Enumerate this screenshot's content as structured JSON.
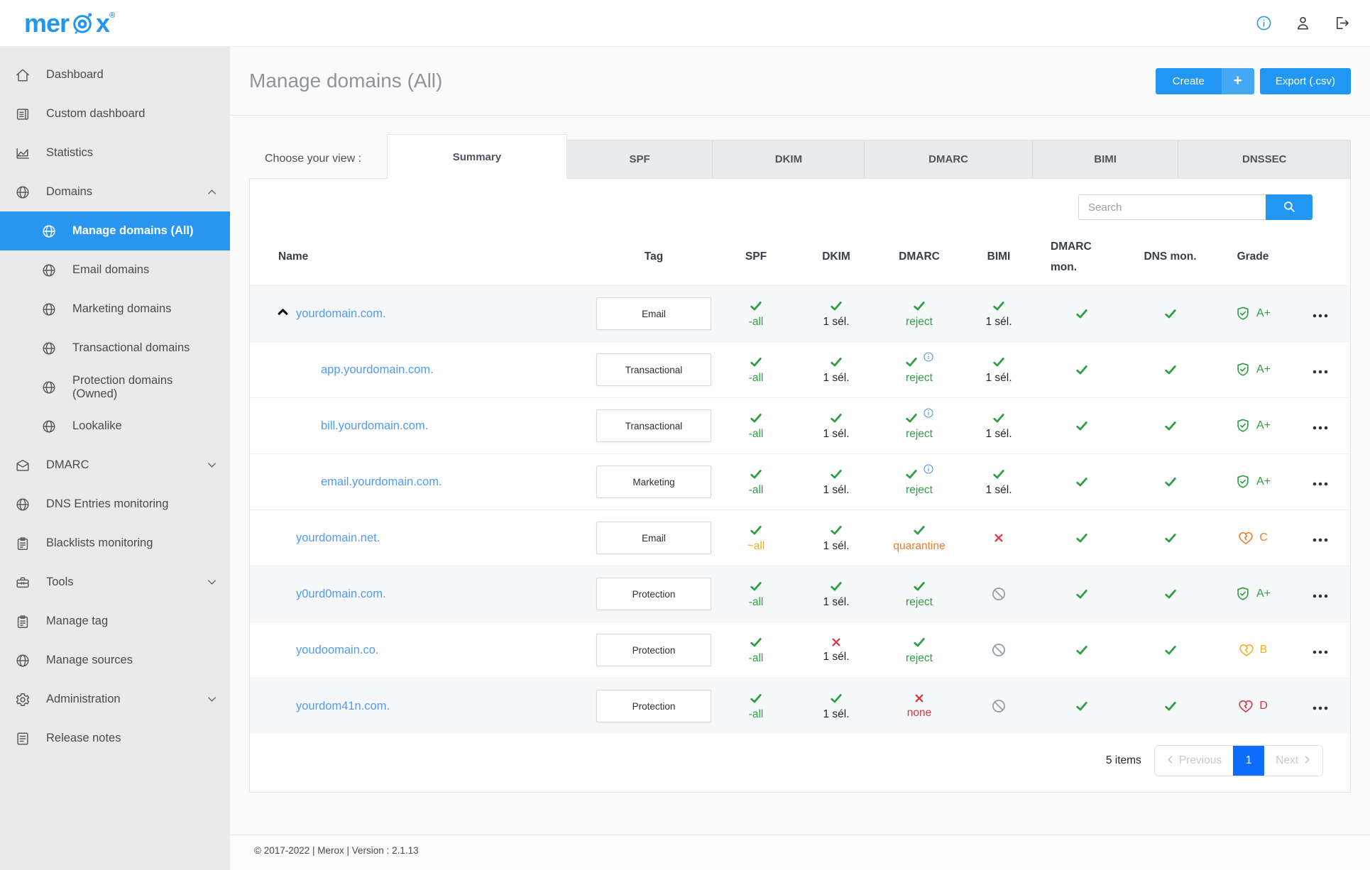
{
  "brand": {
    "logo_left": "mer",
    "logo_right": "x",
    "reg": "®",
    "o_icon": "orbit-target-icon"
  },
  "colors": {
    "accent_blue": "#2196f3",
    "pagination_blue": "#0d6efd",
    "sidebar_active": "#2997f2",
    "check_green": "#2f9e44",
    "x_red": "#d63a49",
    "ban_gray": "#94a1ad",
    "gold": "#f2b01e",
    "orange": "#ed7d31",
    "red": "#dc3545",
    "link_blue": "#4f9bf5"
  },
  "header_icons": [
    {
      "name": "info-icon"
    },
    {
      "name": "user-icon"
    },
    {
      "name": "logout-icon"
    }
  ],
  "sidebar": {
    "items": [
      {
        "label": "Dashboard",
        "icon": "home"
      },
      {
        "label": "Custom dashboard",
        "icon": "custom-dashboard"
      },
      {
        "label": "Statistics",
        "icon": "statistics"
      },
      {
        "label": "Domains",
        "icon": "globe",
        "chevron": "up"
      },
      {
        "label": "Manage domains (All)",
        "icon": "globe",
        "child": true,
        "active": true
      },
      {
        "label": "Email domains",
        "icon": "globe",
        "child": true
      },
      {
        "label": "Marketing domains",
        "icon": "globe",
        "child": true
      },
      {
        "label": "Transactional domains",
        "icon": "globe",
        "child": true
      },
      {
        "label": "Protection domains (Owned)",
        "icon": "globe",
        "child": true
      },
      {
        "label": "Lookalike",
        "icon": "globe",
        "child": true
      },
      {
        "label": "DMARC",
        "icon": "envelope",
        "chevron": "down"
      },
      {
        "label": "DNS Entries monitoring",
        "icon": "globe"
      },
      {
        "label": "Blacklists monitoring",
        "icon": "clipboard"
      },
      {
        "label": "Tools",
        "icon": "toolbox",
        "chevron": "down"
      },
      {
        "label": "Manage tag",
        "icon": "clipboard"
      },
      {
        "label": "Manage sources",
        "icon": "globe"
      },
      {
        "label": "Administration",
        "icon": "gear",
        "chevron": "down"
      },
      {
        "label": "Release notes",
        "icon": "notes"
      }
    ]
  },
  "page": {
    "title": "Manage domains (All)",
    "create_label": "Create",
    "create_plus": "+",
    "export_label": "Export (.csv)"
  },
  "tabs": {
    "label": "Choose your view :",
    "items": [
      {
        "label": "Summary",
        "active": true,
        "flex": 1.23
      },
      {
        "label": "SPF",
        "flex": 1.0
      },
      {
        "label": "DKIM",
        "flex": 1.04
      },
      {
        "label": "DMARC",
        "flex": 1.15
      },
      {
        "label": "BIMI",
        "flex": 1.0
      },
      {
        "label": "DNSSEC",
        "flex": 1.18
      }
    ]
  },
  "search": {
    "placeholder": "Search",
    "button_icon": "search-icon"
  },
  "table": {
    "columns": [
      {
        "label": "Name",
        "cls": "name"
      },
      {
        "label": "Tag"
      },
      {
        "label": "SPF"
      },
      {
        "label": "DKIM"
      },
      {
        "label": "DMARC"
      },
      {
        "label": "BIMI"
      },
      {
        "label": "DMARC mon.",
        "cls": "dmarcmon"
      },
      {
        "label": "DNS mon."
      },
      {
        "label": "Grade"
      },
      {
        "label": ""
      }
    ],
    "rows": [
      {
        "name": "yourdomain.com.",
        "level": "parent",
        "expanded": true,
        "striped": true,
        "tag": "Email",
        "spf": {
          "mark": "check",
          "label": "-all",
          "tone": "green"
        },
        "dkim": {
          "mark": "check",
          "label": "1 sél.",
          "tone": "dark"
        },
        "dmarc": {
          "mark": "check",
          "label": "reject",
          "tone": "green"
        },
        "bimi": {
          "mark": "check",
          "label": "1 sél.",
          "tone": "dark"
        },
        "dmarc_mon": {
          "mark": "check"
        },
        "dns_mon": {
          "mark": "check"
        },
        "grade": {
          "icon": "shield",
          "label": "A+",
          "tone": "green"
        }
      },
      {
        "name": "app.yourdomain.com.",
        "level": "child",
        "tag": "Transactional",
        "spf": {
          "mark": "check",
          "label": "-all",
          "tone": "green"
        },
        "dkim": {
          "mark": "check",
          "label": "1 sél.",
          "tone": "dark"
        },
        "dmarc": {
          "mark": "check",
          "info": true,
          "label": "reject",
          "tone": "green"
        },
        "bimi": {
          "mark": "check",
          "label": "1 sél.",
          "tone": "dark"
        },
        "dmarc_mon": {
          "mark": "check"
        },
        "dns_mon": {
          "mark": "check"
        },
        "grade": {
          "icon": "shield",
          "label": "A+",
          "tone": "green"
        }
      },
      {
        "name": "bill.yourdomain.com.",
        "level": "child",
        "tag": "Transactional",
        "spf": {
          "mark": "check",
          "label": "-all",
          "tone": "green"
        },
        "dkim": {
          "mark": "check",
          "label": "1 sél.",
          "tone": "dark"
        },
        "dmarc": {
          "mark": "check",
          "info": true,
          "label": "reject",
          "tone": "green"
        },
        "bimi": {
          "mark": "check",
          "label": "1 sél.",
          "tone": "dark"
        },
        "dmarc_mon": {
          "mark": "check"
        },
        "dns_mon": {
          "mark": "check"
        },
        "grade": {
          "icon": "shield",
          "label": "A+",
          "tone": "green"
        }
      },
      {
        "name": "email.yourdomain.com.",
        "level": "child",
        "tag": "Marketing",
        "spf": {
          "mark": "check",
          "label": "-all",
          "tone": "green"
        },
        "dkim": {
          "mark": "check",
          "label": "1 sél.",
          "tone": "dark"
        },
        "dmarc": {
          "mark": "check",
          "info": true,
          "label": "reject",
          "tone": "green"
        },
        "bimi": {
          "mark": "check",
          "label": "1 sél.",
          "tone": "dark"
        },
        "dmarc_mon": {
          "mark": "check"
        },
        "dns_mon": {
          "mark": "check"
        },
        "grade": {
          "icon": "shield",
          "label": "A+",
          "tone": "green"
        }
      },
      {
        "name": "yourdomain.net.",
        "level": "top",
        "tag": "Email",
        "spf": {
          "mark": "check",
          "label": "~all",
          "tone": "gold"
        },
        "dkim": {
          "mark": "check",
          "label": "1 sél.",
          "tone": "dark"
        },
        "dmarc": {
          "mark": "check",
          "label": "quarantine",
          "tone": "orange"
        },
        "bimi": {
          "mark": "x"
        },
        "dmarc_mon": {
          "mark": "check"
        },
        "dns_mon": {
          "mark": "check"
        },
        "grade": {
          "icon": "heart",
          "label": "C",
          "tone": "orange"
        }
      },
      {
        "name": "y0urd0main.com.",
        "level": "top",
        "striped": true,
        "tag": "Protection",
        "spf": {
          "mark": "check",
          "label": "-all",
          "tone": "green"
        },
        "dkim": {
          "mark": "check",
          "label": "1 sél.",
          "tone": "dark"
        },
        "dmarc": {
          "mark": "check",
          "label": "reject",
          "tone": "green"
        },
        "bimi": {
          "mark": "ban"
        },
        "dmarc_mon": {
          "mark": "check"
        },
        "dns_mon": {
          "mark": "check"
        },
        "grade": {
          "icon": "shield",
          "label": "A+",
          "tone": "green"
        }
      },
      {
        "name": "youdoomain.co.",
        "level": "top",
        "tag": "Protection",
        "spf": {
          "mark": "check",
          "label": "-all",
          "tone": "green"
        },
        "dkim": {
          "mark": "x",
          "label": "1 sél.",
          "tone": "dark"
        },
        "dmarc": {
          "mark": "check",
          "label": "reject",
          "tone": "green"
        },
        "bimi": {
          "mark": "ban"
        },
        "dmarc_mon": {
          "mark": "check"
        },
        "dns_mon": {
          "mark": "check"
        },
        "grade": {
          "icon": "heart",
          "label": "B",
          "tone": "gold"
        }
      },
      {
        "name": "yourdom41n.com.",
        "level": "top",
        "striped": true,
        "tag": "Protection",
        "spf": {
          "mark": "check",
          "label": "-all",
          "tone": "green"
        },
        "dkim": {
          "mark": "check",
          "label": "1 sél.",
          "tone": "dark"
        },
        "dmarc": {
          "mark": "x",
          "label": "none",
          "tone": "red"
        },
        "bimi": {
          "mark": "ban"
        },
        "dmarc_mon": {
          "mark": "check"
        },
        "dns_mon": {
          "mark": "check"
        },
        "grade": {
          "icon": "heart",
          "label": "D",
          "tone": "red"
        }
      }
    ]
  },
  "pagination": {
    "items_text": "5 items",
    "prev": "Previous",
    "page": "1",
    "next": "Next"
  },
  "footer": {
    "text": "© 2017-2022 | Merox | Version : 2.1.13"
  }
}
